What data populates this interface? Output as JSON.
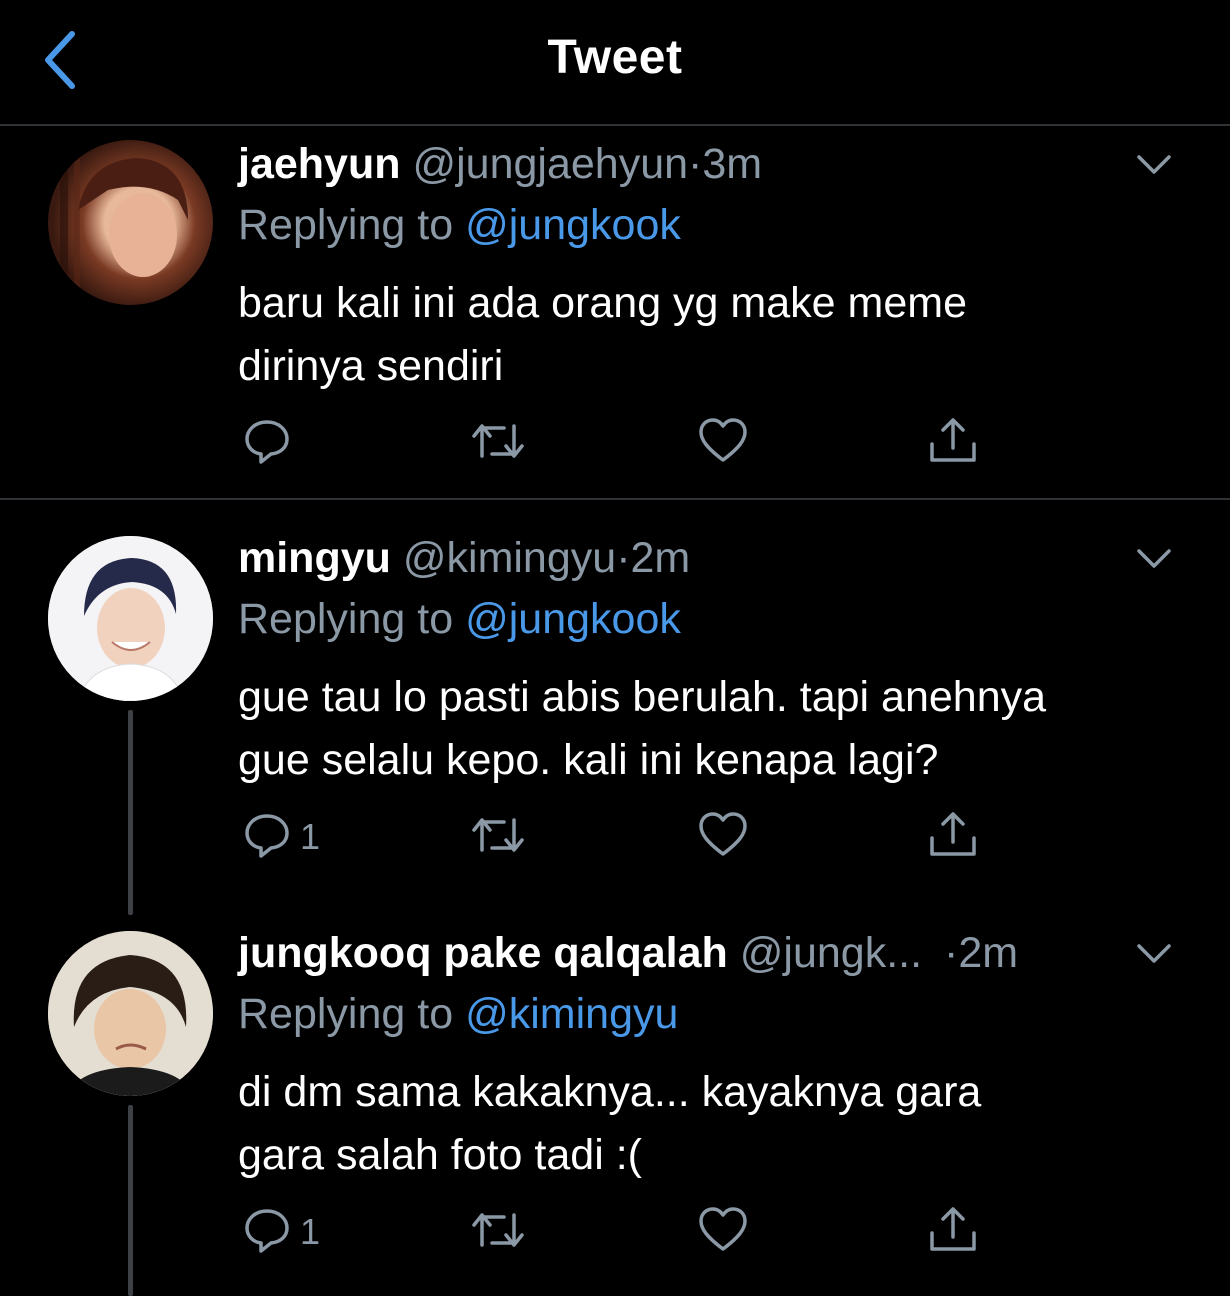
{
  "header": {
    "title": "Tweet"
  },
  "tweets": [
    {
      "name": "jaehyun",
      "handle": "@jungjaehyun",
      "dot": "·",
      "time": "3m",
      "replying_prefix": "Replying to",
      "replying_to": "@jungkook",
      "text_line1": "baru kali ini ada orang yg make meme",
      "text_line2": "dirinya sendiri",
      "reply_count": ""
    },
    {
      "name": "mingyu",
      "handle": "@kimingyu",
      "dot": "·",
      "time": "2m",
      "replying_prefix": "Replying to",
      "replying_to": "@jungkook",
      "text_line1": "gue tau lo pasti abis berulah. tapi anehnya",
      "text_line2": "gue selalu kepo. kali ini kenapa lagi?",
      "reply_count": "1"
    },
    {
      "name": "jungkooq pake qalqalah",
      "handle": "@jungk...",
      "dot": "·",
      "time": "2m",
      "replying_prefix": "Replying to",
      "replying_to": "@kimingyu",
      "text_line1": "di dm sama kakaknya... kayaknya gara",
      "text_line2": "gara salah foto tadi :(",
      "reply_count": "1"
    }
  ],
  "colors": {
    "background": "#000000",
    "text": "#ffffff",
    "secondary": "#8b98a5",
    "accent": "#4a99e9",
    "divider": "#2f3336"
  },
  "icons": {
    "back": "chevron-left-icon",
    "more": "chevron-down-icon",
    "reply": "comment-icon",
    "retweet": "retweet-icon",
    "like": "heart-icon",
    "share": "share-icon"
  }
}
